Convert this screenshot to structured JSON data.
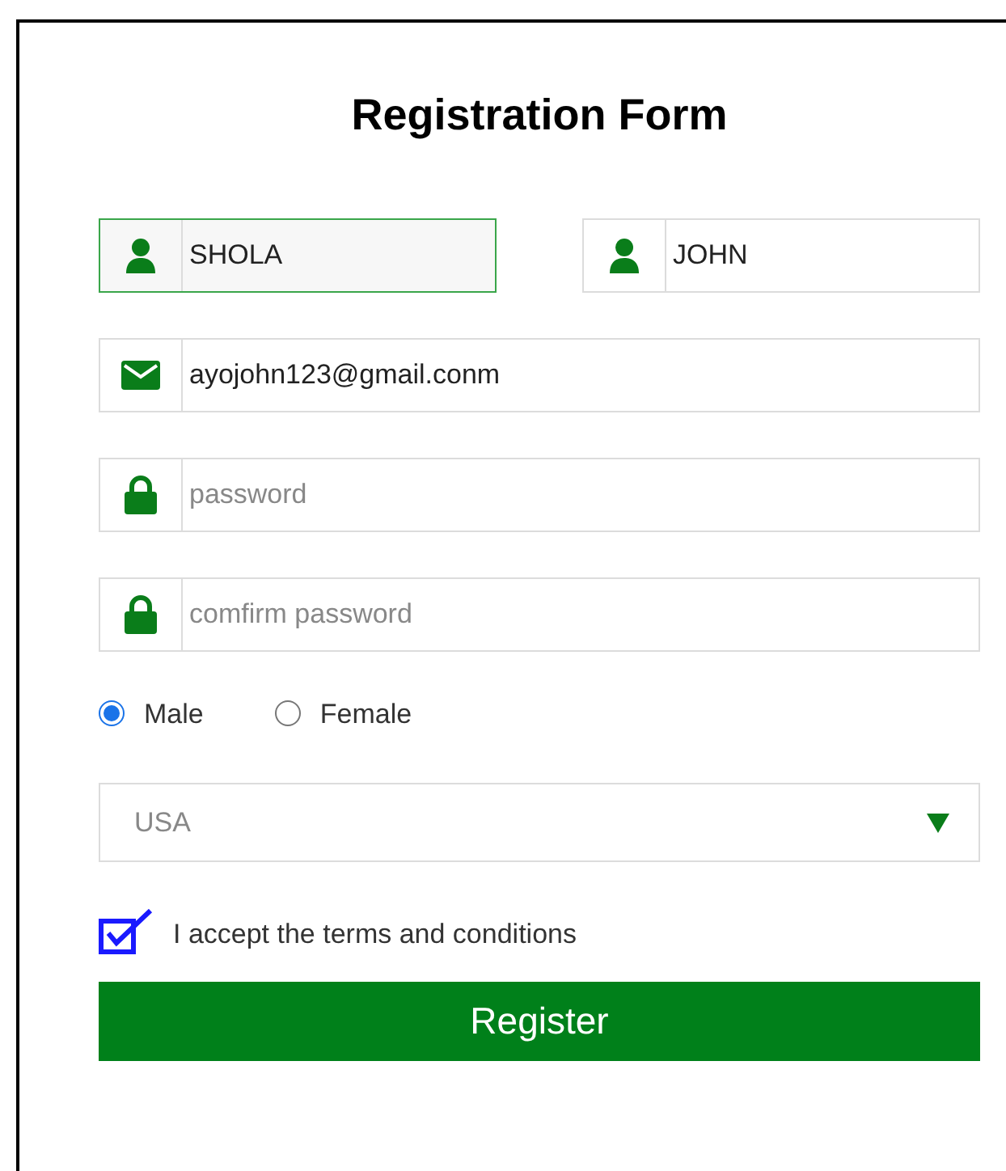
{
  "title": "Registration Form",
  "name_fields": [
    {
      "kind": "person",
      "value": "SHOLA",
      "focused": true
    },
    {
      "kind": "person",
      "value": "JOHN",
      "focused": false
    }
  ],
  "fields": [
    {
      "kind": "email",
      "value": "ayojohn123@gmail.conm"
    },
    {
      "kind": "password",
      "placeholder": "password"
    },
    {
      "kind": "password",
      "placeholder": "comfirm password"
    }
  ],
  "gender": [
    {
      "label": "Male",
      "selected": true
    },
    {
      "label": "Female",
      "selected": false
    }
  ],
  "country": {
    "value": "USA"
  },
  "terms": {
    "label": "I accept the terms and conditions",
    "checked": true
  },
  "register_button": "Register"
}
